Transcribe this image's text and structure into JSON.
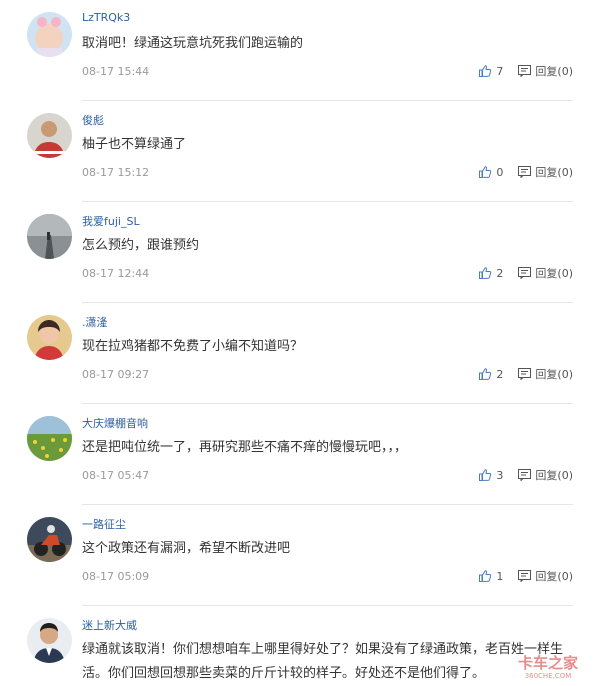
{
  "comments": [
    {
      "username": "LzTRQk3",
      "content": "取消吧！绿通这玩意坑死我们跑运输的",
      "time": "08-17 15:44",
      "likes": "7",
      "reply_label": "回复(0)",
      "avatar_icon": "baby-avatar"
    },
    {
      "username": "俊彪",
      "content": "柚子也不算绿通了",
      "time": "08-17 15:12",
      "likes": "0",
      "reply_label": "回复(0)",
      "avatar_icon": "man-avatar"
    },
    {
      "username": "我爱fuji_SL",
      "content": "怎么预约，跟谁预约",
      "time": "08-17 12:44",
      "likes": "2",
      "reply_label": "回复(0)",
      "avatar_icon": "foggy-road-avatar"
    },
    {
      "username": ".潇湰",
      "content": "现在拉鸡猪都不免费了小编不知道吗？",
      "time": "08-17 09:27",
      "likes": "2",
      "reply_label": "回复(0)",
      "avatar_icon": "woman-avatar"
    },
    {
      "username": "大庆爆棚音响",
      "content": "还是把吨位统一了，再研究那些不痛不痒的慢慢玩吧，，，",
      "time": "08-17 05:47",
      "likes": "3",
      "reply_label": "回复(0)",
      "avatar_icon": "flower-field-avatar"
    },
    {
      "username": "一路征尘",
      "content": "这个政策还有漏洞，希望不断改进吧",
      "time": "08-17 05:09",
      "likes": "1",
      "reply_label": "回复(0)",
      "avatar_icon": "motorcycle-avatar"
    },
    {
      "username": "迷上新大威",
      "content": "绿通就该取消！你们想想咱车上哪里得好处了？如果没有了绿通政策，老百姓一样生活。你们回想回想那些卖菜的斤斤计较的样子。好处还不是他们得了。",
      "time": "",
      "likes": "",
      "reply_label": "",
      "avatar_icon": "man-portrait-avatar"
    }
  ],
  "icons": {
    "like": "thumbs-up-icon",
    "reply": "comment-icon"
  },
  "watermark": {
    "text": "卡车之家",
    "subtext": "360CHE.COM",
    "color": "#d02f2f"
  }
}
